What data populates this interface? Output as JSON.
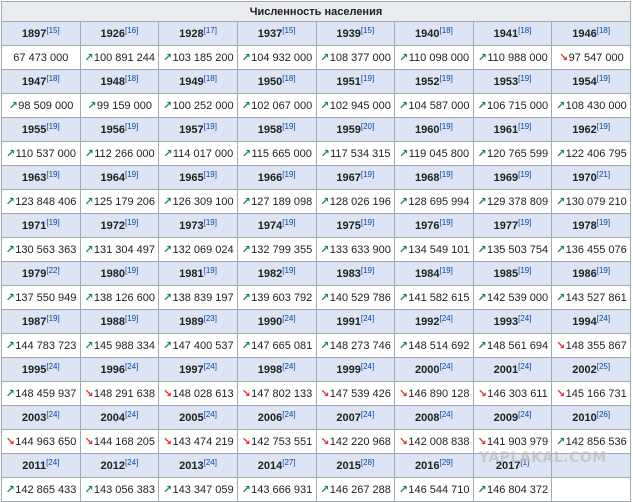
{
  "title": "Численность населения",
  "rows": [
    {
      "years": [
        [
          "1897",
          "[15]"
        ],
        [
          "1926",
          "[16]"
        ],
        [
          "1928",
          "[17]"
        ],
        [
          "1937",
          "[15]"
        ],
        [
          "1939",
          "[15]"
        ],
        [
          "1940",
          "[18]"
        ],
        [
          "1941",
          "[18]"
        ],
        [
          "1946",
          "[18]"
        ]
      ],
      "values": [
        [
          "",
          "67 473 000"
        ],
        [
          "up",
          "100 891 244"
        ],
        [
          "up",
          "103 185 200"
        ],
        [
          "up",
          "104 932 000"
        ],
        [
          "up",
          "108 377 000"
        ],
        [
          "up",
          "110 098 000"
        ],
        [
          "up",
          "110 988 000"
        ],
        [
          "down",
          "97 547 000"
        ]
      ]
    },
    {
      "years": [
        [
          "1947",
          "[18]"
        ],
        [
          "1948",
          "[18]"
        ],
        [
          "1949",
          "[18]"
        ],
        [
          "1950",
          "[18]"
        ],
        [
          "1951",
          "[19]"
        ],
        [
          "1952",
          "[19]"
        ],
        [
          "1953",
          "[19]"
        ],
        [
          "1954",
          "[19]"
        ]
      ],
      "values": [
        [
          "up",
          "98 509 000"
        ],
        [
          "up",
          "99 159 000"
        ],
        [
          "up",
          "100 252 000"
        ],
        [
          "up",
          "102 067 000"
        ],
        [
          "up",
          "102 945 000"
        ],
        [
          "up",
          "104 587 000"
        ],
        [
          "up",
          "106 715 000"
        ],
        [
          "up",
          "108 430 000"
        ]
      ]
    },
    {
      "years": [
        [
          "1955",
          "[19]"
        ],
        [
          "1956",
          "[19]"
        ],
        [
          "1957",
          "[19]"
        ],
        [
          "1958",
          "[19]"
        ],
        [
          "1959",
          "[20]"
        ],
        [
          "1960",
          "[19]"
        ],
        [
          "1961",
          "[19]"
        ],
        [
          "1962",
          "[19]"
        ]
      ],
      "values": [
        [
          "up",
          "110 537 000"
        ],
        [
          "up",
          "112 266 000"
        ],
        [
          "up",
          "114 017 000"
        ],
        [
          "up",
          "115 665 000"
        ],
        [
          "up",
          "117 534 315"
        ],
        [
          "up",
          "119 045 800"
        ],
        [
          "up",
          "120 765 599"
        ],
        [
          "up",
          "122 406 795"
        ]
      ]
    },
    {
      "years": [
        [
          "1963",
          "[19]"
        ],
        [
          "1964",
          "[19]"
        ],
        [
          "1965",
          "[19]"
        ],
        [
          "1966",
          "[19]"
        ],
        [
          "1967",
          "[19]"
        ],
        [
          "1968",
          "[19]"
        ],
        [
          "1969",
          "[19]"
        ],
        [
          "1970",
          "[21]"
        ]
      ],
      "values": [
        [
          "up",
          "123 848 406"
        ],
        [
          "up",
          "125 179 206"
        ],
        [
          "up",
          "126 309 100"
        ],
        [
          "up",
          "127 189 098"
        ],
        [
          "up",
          "128 026 196"
        ],
        [
          "up",
          "128 695 994"
        ],
        [
          "up",
          "129 378 809"
        ],
        [
          "up",
          "130 079 210"
        ]
      ]
    },
    {
      "years": [
        [
          "1971",
          "[19]"
        ],
        [
          "1972",
          "[19]"
        ],
        [
          "1973",
          "[19]"
        ],
        [
          "1974",
          "[19]"
        ],
        [
          "1975",
          "[19]"
        ],
        [
          "1976",
          "[19]"
        ],
        [
          "1977",
          "[19]"
        ],
        [
          "1978",
          "[19]"
        ]
      ],
      "values": [
        [
          "up",
          "130 563 363"
        ],
        [
          "up",
          "131 304 497"
        ],
        [
          "up",
          "132 069 024"
        ],
        [
          "up",
          "132 799 355"
        ],
        [
          "up",
          "133 633 900"
        ],
        [
          "up",
          "134 549 101"
        ],
        [
          "up",
          "135 503 754"
        ],
        [
          "up",
          "136 455 076"
        ]
      ]
    },
    {
      "years": [
        [
          "1979",
          "[22]"
        ],
        [
          "1980",
          "[19]"
        ],
        [
          "1981",
          "[19]"
        ],
        [
          "1982",
          "[19]"
        ],
        [
          "1983",
          "[19]"
        ],
        [
          "1984",
          "[19]"
        ],
        [
          "1985",
          "[19]"
        ],
        [
          "1986",
          "[19]"
        ]
      ],
      "values": [
        [
          "up",
          "137 550 949"
        ],
        [
          "up",
          "138 126 600"
        ],
        [
          "up",
          "138 839 197"
        ],
        [
          "up",
          "139 603 792"
        ],
        [
          "up",
          "140 529 786"
        ],
        [
          "up",
          "141 582 615"
        ],
        [
          "up",
          "142 539 000"
        ],
        [
          "up",
          "143 527 861"
        ]
      ]
    },
    {
      "years": [
        [
          "1987",
          "[19]"
        ],
        [
          "1988",
          "[19]"
        ],
        [
          "1989",
          "[23]"
        ],
        [
          "1990",
          "[24]"
        ],
        [
          "1991",
          "[24]"
        ],
        [
          "1992",
          "[24]"
        ],
        [
          "1993",
          "[24]"
        ],
        [
          "1994",
          "[24]"
        ]
      ],
      "values": [
        [
          "up",
          "144 783 723"
        ],
        [
          "up",
          "145 988 334"
        ],
        [
          "up",
          "147 400 537"
        ],
        [
          "up",
          "147 665 081"
        ],
        [
          "up",
          "148 273 746"
        ],
        [
          "up",
          "148 514 692"
        ],
        [
          "up",
          "148 561 694"
        ],
        [
          "down",
          "148 355 867"
        ]
      ]
    },
    {
      "years": [
        [
          "1995",
          "[24]"
        ],
        [
          "1996",
          "[24]"
        ],
        [
          "1997",
          "[24]"
        ],
        [
          "1998",
          "[24]"
        ],
        [
          "1999",
          "[24]"
        ],
        [
          "2000",
          "[24]"
        ],
        [
          "2001",
          "[24]"
        ],
        [
          "2002",
          "[25]"
        ]
      ],
      "values": [
        [
          "up",
          "148 459 937"
        ],
        [
          "down",
          "148 291 638"
        ],
        [
          "down",
          "148 028 613"
        ],
        [
          "down",
          "147 802 133"
        ],
        [
          "down",
          "147 539 426"
        ],
        [
          "down",
          "146 890 128"
        ],
        [
          "down",
          "146 303 611"
        ],
        [
          "down",
          "145 166 731"
        ]
      ]
    },
    {
      "years": [
        [
          "2003",
          "[24]"
        ],
        [
          "2004",
          "[24]"
        ],
        [
          "2005",
          "[24]"
        ],
        [
          "2006",
          "[24]"
        ],
        [
          "2007",
          "[24]"
        ],
        [
          "2008",
          "[24]"
        ],
        [
          "2009",
          "[24]"
        ],
        [
          "2010",
          "[26]"
        ]
      ],
      "values": [
        [
          "down",
          "144 963 650"
        ],
        [
          "down",
          "144 168 205"
        ],
        [
          "down",
          "143 474 219"
        ],
        [
          "down",
          "142 753 551"
        ],
        [
          "down",
          "142 220 968"
        ],
        [
          "down",
          "142 008 838"
        ],
        [
          "down",
          "141 903 979"
        ],
        [
          "up",
          "142 856 536"
        ]
      ]
    },
    {
      "years": [
        [
          "2011",
          "[24]"
        ],
        [
          "2012",
          "[24]"
        ],
        [
          "2013",
          "[24]"
        ],
        [
          "2014",
          "[27]"
        ],
        [
          "2015",
          "[28]"
        ],
        [
          "2016",
          "[29]"
        ],
        [
          "2017",
          "[1]"
        ],
        [
          "",
          ""
        ]
      ],
      "values": [
        [
          "up",
          "142 865 433"
        ],
        [
          "up",
          "143 056 383"
        ],
        [
          "up",
          "143 347 059"
        ],
        [
          "up",
          "143 666 931"
        ],
        [
          "up",
          "146 267 288"
        ],
        [
          "up",
          "146 544 710"
        ],
        [
          "up",
          "146 804 372"
        ],
        [
          "",
          ""
        ]
      ]
    }
  ],
  "watermark": "YAPLAKAL.COM"
}
